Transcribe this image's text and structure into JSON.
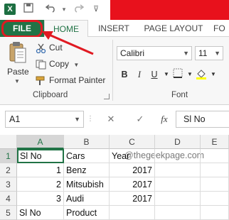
{
  "app": {
    "icon_label": "X"
  },
  "tabs": [
    {
      "label": "FILE"
    },
    {
      "label": "HOME"
    },
    {
      "label": "INSERT"
    },
    {
      "label": "PAGE LAYOUT"
    },
    {
      "label": "FO"
    }
  ],
  "clipboard": {
    "paste": "Paste",
    "cut": "Cut",
    "copy": "Copy",
    "format_painter": "Format Painter",
    "group_label": "Clipboard"
  },
  "font": {
    "name": "Calibri",
    "size": "11",
    "bold": "B",
    "italic": "I",
    "underline": "U",
    "group_label": "Font"
  },
  "formula_bar": {
    "name_box": "A1",
    "cancel": "✕",
    "enter": "✓",
    "fx": "fx",
    "content": "Sl No"
  },
  "watermark": "@thegeekpage.com",
  "grid": {
    "columns": [
      "A",
      "B",
      "C",
      "D",
      "E"
    ],
    "rows": [
      {
        "num": "1",
        "cells": [
          "Sl No",
          "Cars",
          "Year",
          "",
          ""
        ]
      },
      {
        "num": "2",
        "cells": [
          "1",
          "Benz",
          "2017",
          "",
          ""
        ]
      },
      {
        "num": "3",
        "cells": [
          "2",
          "Mitsubish",
          "2017",
          "",
          ""
        ]
      },
      {
        "num": "4",
        "cells": [
          "3",
          "Audi",
          "2017",
          "",
          ""
        ]
      },
      {
        "num": "5",
        "cells": [
          "Sl No",
          "Product",
          "",
          "",
          ""
        ]
      }
    ]
  },
  "colors": {
    "excel_green": "#217346",
    "highlight_red": "#e01a22",
    "banner_red": "#e8111c"
  }
}
